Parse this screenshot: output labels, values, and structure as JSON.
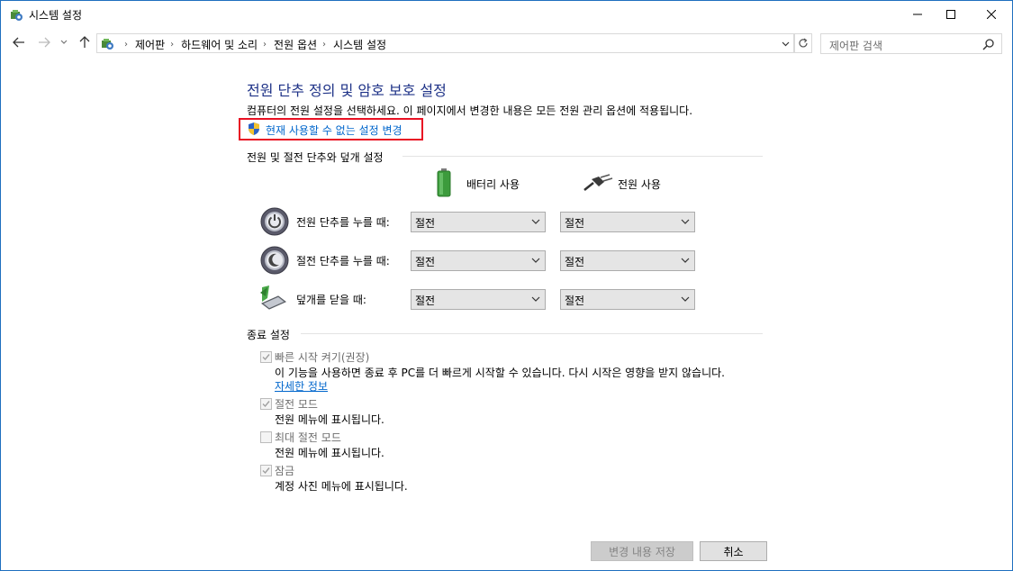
{
  "window": {
    "title": "시스템 설정"
  },
  "nav": {
    "breadcrumbs": [
      "제어판",
      "하드웨어 및 소리",
      "전원 옵션",
      "시스템 설정"
    ],
    "search_placeholder": "제어판 검색"
  },
  "page": {
    "heading": "전원 단추 정의 및 암호 보호 설정",
    "description": "컴퓨터의 전원 설정을 선택하세요. 이 페이지에서 변경한 내용은 모든 전원 관리 옵션에 적용됩니다.",
    "change_link": "현재 사용할 수 없는 설정 변경"
  },
  "buttons_section": {
    "title": "전원 및 절전 단추와 덮개 설정",
    "col_battery": "배터리 사용",
    "col_plugged": "전원 사용",
    "rows": [
      {
        "label": "전원 단추를 누를 때:",
        "battery": "절전",
        "plugged": "절전",
        "icon": "power-button-icon"
      },
      {
        "label": "절전 단추를 누를 때:",
        "battery": "절전",
        "plugged": "절전",
        "icon": "sleep-button-icon"
      },
      {
        "label": "덮개를 닫을 때:",
        "battery": "절전",
        "plugged": "절전",
        "icon": "lid-close-icon"
      }
    ]
  },
  "shutdown_section": {
    "title": "종료 설정",
    "options": [
      {
        "label": "빠른 시작 켜기(권장)",
        "checked": true,
        "desc": "이 기능을 사용하면 종료 후 PC를 더 빠르게 시작할 수 있습니다. 다시 시작은 영향을 받지 않습니다.",
        "link": "자세한 정보"
      },
      {
        "label": "절전 모드",
        "checked": true,
        "desc": "전원 메뉴에 표시됩니다."
      },
      {
        "label": "최대 절전 모드",
        "checked": false,
        "desc": "전원 메뉴에 표시됩니다."
      },
      {
        "label": "잠금",
        "checked": true,
        "desc": "계정 사진 메뉴에 표시됩니다."
      }
    ]
  },
  "footer": {
    "save": "변경 내용 저장",
    "cancel": "취소"
  }
}
